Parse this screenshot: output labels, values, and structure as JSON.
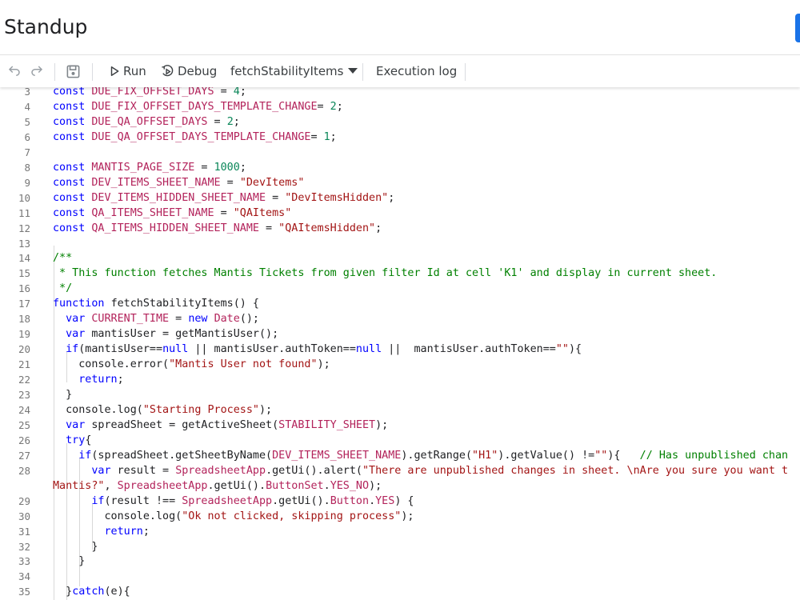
{
  "title": "Standup",
  "toolbar": {
    "undo_icon": "undo-icon",
    "redo_icon": "redo-icon",
    "save_icon": "save-icon",
    "run_label": "Run",
    "debug_label": "Debug",
    "function_select": "fetchStabilityItems",
    "execution_log_label": "Execution log"
  },
  "colors": {
    "accent": "#1a73e8",
    "keyword": "#0000ff",
    "constant": "#b3235b",
    "string": "#a31515",
    "number": "#098658",
    "comment": "#008000"
  },
  "code_lines": [
    {
      "n": "3",
      "t": [
        [
          "k",
          "const "
        ],
        [
          "c",
          "DUE_FIX_OFFSET_DAYS"
        ],
        [
          "p",
          " = "
        ],
        [
          "n",
          "4"
        ],
        [
          "p",
          ";"
        ]
      ]
    },
    {
      "n": "4",
      "t": [
        [
          "k",
          "const "
        ],
        [
          "c",
          "DUE_FIX_OFFSET_DAYS_TEMPLATE_CHANGE"
        ],
        [
          "p",
          "= "
        ],
        [
          "n",
          "2"
        ],
        [
          "p",
          ";"
        ]
      ]
    },
    {
      "n": "5",
      "t": [
        [
          "k",
          "const "
        ],
        [
          "c",
          "DUE_QA_OFFSET_DAYS"
        ],
        [
          "p",
          " = "
        ],
        [
          "n",
          "2"
        ],
        [
          "p",
          ";"
        ]
      ]
    },
    {
      "n": "6",
      "t": [
        [
          "k",
          "const "
        ],
        [
          "c",
          "DUE_QA_OFFSET_DAYS_TEMPLATE_CHANGE"
        ],
        [
          "p",
          "= "
        ],
        [
          "n",
          "1"
        ],
        [
          "p",
          ";"
        ]
      ]
    },
    {
      "n": "7",
      "t": []
    },
    {
      "n": "8",
      "t": [
        [
          "k",
          "const "
        ],
        [
          "c",
          "MANTIS_PAGE_SIZE"
        ],
        [
          "p",
          " = "
        ],
        [
          "n",
          "1000"
        ],
        [
          "p",
          ";"
        ]
      ]
    },
    {
      "n": "9",
      "t": [
        [
          "k",
          "const "
        ],
        [
          "c",
          "DEV_ITEMS_SHEET_NAME"
        ],
        [
          "p",
          " = "
        ],
        [
          "s",
          "\"DevItems\""
        ]
      ]
    },
    {
      "n": "10",
      "t": [
        [
          "k",
          "const "
        ],
        [
          "c",
          "DEV_ITEMS_HIDDEN_SHEET_NAME"
        ],
        [
          "p",
          " = "
        ],
        [
          "s",
          "\"DevItemsHidden\""
        ],
        [
          "p",
          ";"
        ]
      ]
    },
    {
      "n": "11",
      "t": [
        [
          "k",
          "const "
        ],
        [
          "c",
          "QA_ITEMS_SHEET_NAME"
        ],
        [
          "p",
          " = "
        ],
        [
          "s",
          "\"QAItems\""
        ]
      ]
    },
    {
      "n": "12",
      "t": [
        [
          "k",
          "const "
        ],
        [
          "c",
          "QA_ITEMS_HIDDEN_SHEET_NAME"
        ],
        [
          "p",
          " = "
        ],
        [
          "s",
          "\"QAItemsHidden\""
        ],
        [
          "p",
          ";"
        ]
      ]
    },
    {
      "n": "13",
      "t": []
    },
    {
      "n": "14",
      "t": [
        [
          "m",
          "/**"
        ]
      ]
    },
    {
      "n": "15",
      "t": [
        [
          "m",
          " * This function fetches Mantis Tickets from given filter Id at cell 'K1' and display in current sheet."
        ]
      ]
    },
    {
      "n": "16",
      "t": [
        [
          "m",
          " */"
        ]
      ]
    },
    {
      "n": "17",
      "t": [
        [
          "k",
          "function "
        ],
        [
          "p",
          "fetchStabilityItems() {"
        ]
      ]
    },
    {
      "n": "18",
      "t": [
        [
          "p",
          "  "
        ],
        [
          "k",
          "var "
        ],
        [
          "c",
          "CURRENT_TIME"
        ],
        [
          "p",
          " = "
        ],
        [
          "k",
          "new "
        ],
        [
          "c",
          "Date"
        ],
        [
          "p",
          "();"
        ]
      ]
    },
    {
      "n": "19",
      "t": [
        [
          "p",
          "  "
        ],
        [
          "k",
          "var "
        ],
        [
          "p",
          "mantisUser = getMantisUser();"
        ]
      ]
    },
    {
      "n": "20",
      "t": [
        [
          "p",
          "  "
        ],
        [
          "k",
          "if"
        ],
        [
          "p",
          "(mantisUser=="
        ],
        [
          "k",
          "null"
        ],
        [
          "p",
          " || mantisUser.authToken=="
        ],
        [
          "k",
          "null"
        ],
        [
          "p",
          " ||  mantisUser.authToken=="
        ],
        [
          "s",
          "\"\""
        ],
        [
          "p",
          "){"
        ]
      ]
    },
    {
      "n": "21",
      "t": [
        [
          "p",
          "    console.error("
        ],
        [
          "s",
          "\"Mantis User not found\""
        ],
        [
          "p",
          ");"
        ]
      ]
    },
    {
      "n": "22",
      "t": [
        [
          "p",
          "    "
        ],
        [
          "k",
          "return"
        ],
        [
          "p",
          ";"
        ]
      ]
    },
    {
      "n": "23",
      "t": [
        [
          "p",
          "  }"
        ]
      ]
    },
    {
      "n": "24",
      "t": [
        [
          "p",
          "  console.log("
        ],
        [
          "s",
          "\"Starting Process\""
        ],
        [
          "p",
          ");"
        ]
      ]
    },
    {
      "n": "25",
      "t": [
        [
          "p",
          "  "
        ],
        [
          "k",
          "var "
        ],
        [
          "p",
          "spreadSheet = getActiveSheet("
        ],
        [
          "c",
          "STABILITY_SHEET"
        ],
        [
          "p",
          ");"
        ]
      ]
    },
    {
      "n": "26",
      "t": [
        [
          "p",
          "  "
        ],
        [
          "k",
          "try"
        ],
        [
          "p",
          "{"
        ]
      ]
    },
    {
      "n": "27",
      "t": [
        [
          "p",
          "    "
        ],
        [
          "k",
          "if"
        ],
        [
          "p",
          "(spreadSheet.getSheetByName("
        ],
        [
          "c",
          "DEV_ITEMS_SHEET_NAME"
        ],
        [
          "p",
          ").getRange("
        ],
        [
          "s",
          "\"H1\""
        ],
        [
          "p",
          ").getValue() !="
        ],
        [
          "s",
          "\"\""
        ],
        [
          "p",
          "){   "
        ],
        [
          "m",
          "// Has unpublished chan"
        ]
      ]
    },
    {
      "n": "28",
      "t": [
        [
          "p",
          "      "
        ],
        [
          "k",
          "var "
        ],
        [
          "p",
          "result = "
        ],
        [
          "c",
          "SpreadsheetApp"
        ],
        [
          "p",
          ".getUi().alert("
        ],
        [
          "s",
          "\"There are unpublished changes in sheet. \\nAre you sure you want t"
        ]
      ]
    },
    {
      "n": "",
      "t": [
        [
          "s",
          "Mantis?\""
        ],
        [
          "p",
          ", "
        ],
        [
          "c",
          "SpreadsheetApp"
        ],
        [
          "p",
          ".getUi()."
        ],
        [
          "c",
          "ButtonSet"
        ],
        [
          "p",
          "."
        ],
        [
          "c",
          "YES_NO"
        ],
        [
          "p",
          ");"
        ]
      ]
    },
    {
      "n": "29",
      "t": [
        [
          "p",
          "      "
        ],
        [
          "k",
          "if"
        ],
        [
          "p",
          "(result !== "
        ],
        [
          "c",
          "SpreadsheetApp"
        ],
        [
          "p",
          ".getUi()."
        ],
        [
          "c",
          "Button"
        ],
        [
          "p",
          "."
        ],
        [
          "c",
          "YES"
        ],
        [
          "p",
          ") {"
        ]
      ]
    },
    {
      "n": "30",
      "t": [
        [
          "p",
          "        console.log("
        ],
        [
          "s",
          "\"Ok not clicked, skipping process\""
        ],
        [
          "p",
          ");"
        ]
      ]
    },
    {
      "n": "31",
      "t": [
        [
          "p",
          "        "
        ],
        [
          "k",
          "return"
        ],
        [
          "p",
          ";"
        ]
      ]
    },
    {
      "n": "32",
      "t": [
        [
          "p",
          "      }"
        ]
      ]
    },
    {
      "n": "33",
      "t": [
        [
          "p",
          "    }"
        ]
      ]
    },
    {
      "n": "34",
      "t": []
    },
    {
      "n": "35",
      "t": [
        [
          "p",
          "  }"
        ],
        [
          "k",
          "catch"
        ],
        [
          "p",
          "(e){"
        ]
      ]
    }
  ]
}
